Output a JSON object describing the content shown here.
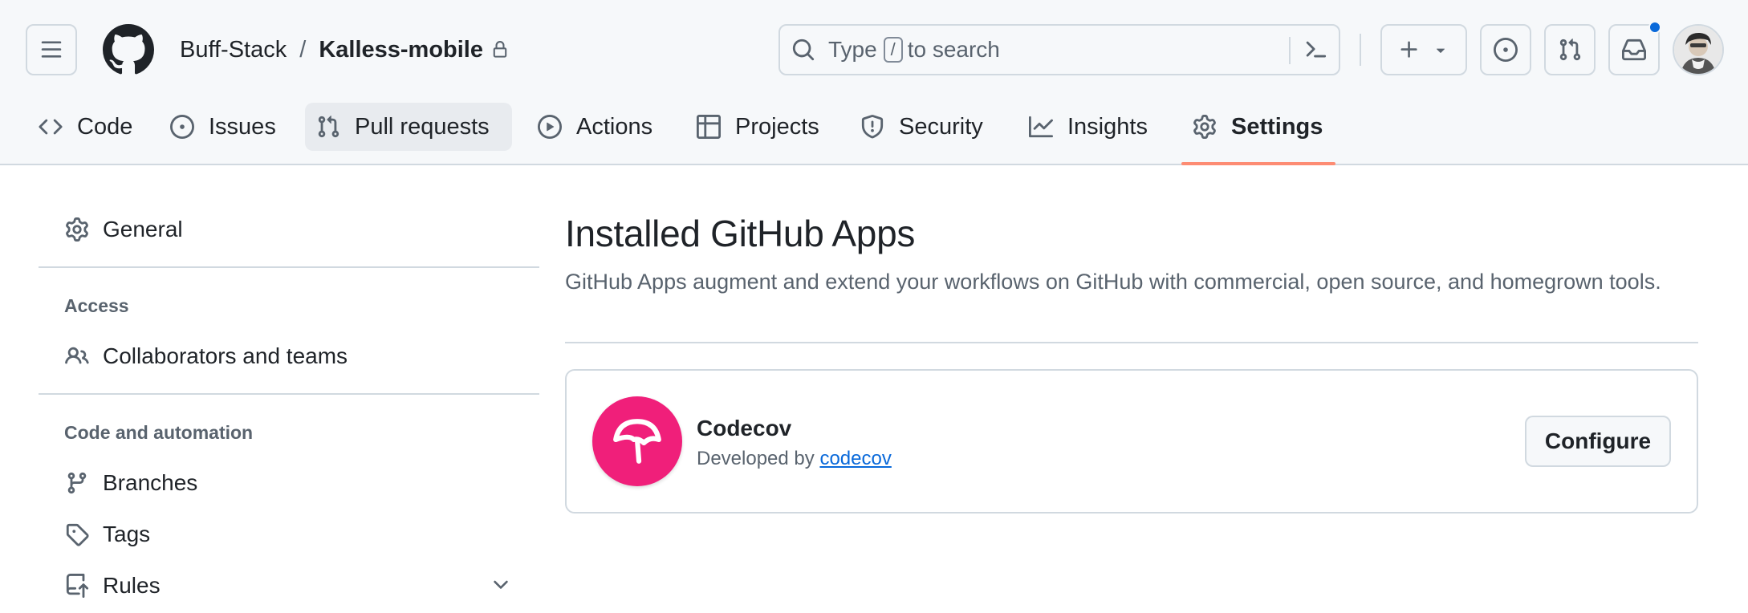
{
  "header": {
    "owner": "Buff-Stack",
    "separator": "/",
    "repo": "Kalless-mobile",
    "search": {
      "prefix": "Type",
      "key": "/",
      "suffix": "to search"
    },
    "notification_color": "#0969da"
  },
  "tabs": [
    {
      "label": "Code",
      "icon": "code-icon"
    },
    {
      "label": "Issues",
      "icon": "issue-icon"
    },
    {
      "label": "Pull requests",
      "icon": "git-pull-request-icon"
    },
    {
      "label": "Actions",
      "icon": "play-icon"
    },
    {
      "label": "Projects",
      "icon": "table-icon"
    },
    {
      "label": "Security",
      "icon": "shield-icon"
    },
    {
      "label": "Insights",
      "icon": "graph-icon"
    },
    {
      "label": "Settings",
      "icon": "gear-icon",
      "active": true
    }
  ],
  "sidebar": {
    "general": "General",
    "access_heading": "Access",
    "collaborators": "Collaborators and teams",
    "code_heading": "Code and automation",
    "branches": "Branches",
    "tags": "Tags",
    "rules": "Rules"
  },
  "main": {
    "title": "Installed GitHub Apps",
    "description": "GitHub Apps augment and extend your workflows on GitHub with commercial, open source, and homegrown tools.",
    "apps": [
      {
        "name": "Codecov",
        "developed_by": "Developed by",
        "developer": "codecov",
        "configure_label": "Configure",
        "logo_color": "#f01f7a"
      }
    ]
  },
  "colors": {
    "accent_underline": "#fd8c73",
    "link": "#0969da",
    "muted_text": "#59636e",
    "border": "#d1d9e0"
  }
}
